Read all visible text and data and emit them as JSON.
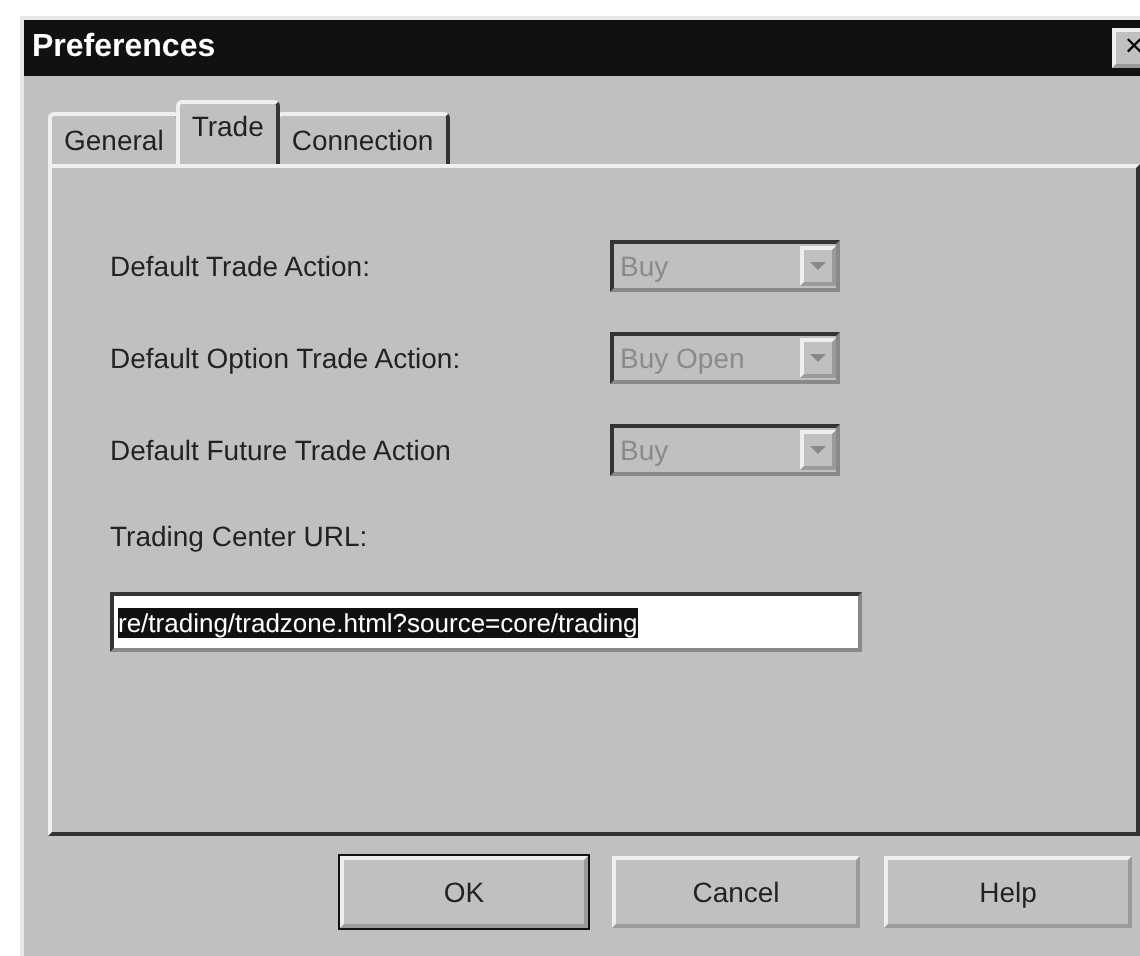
{
  "window": {
    "title": "Preferences",
    "close": "×"
  },
  "tabs": [
    {
      "label": "General",
      "selected": false
    },
    {
      "label": "Trade",
      "selected": true
    },
    {
      "label": "Connection",
      "selected": false
    }
  ],
  "fields": [
    {
      "label": "Default Trade Action:",
      "value": "Buy",
      "disabled": true
    },
    {
      "label": "Default Option Trade Action:",
      "value": "Buy Open",
      "disabled": true
    },
    {
      "label": "Default Future Trade Action",
      "value": "Buy",
      "disabled": true
    }
  ],
  "url": {
    "label": "Trading Center URL:",
    "value": "re/trading/tradzone.html?source=core/trading",
    "selected": true
  },
  "buttons": [
    {
      "label": "OK",
      "default": true
    },
    {
      "label": "Cancel",
      "default": false
    },
    {
      "label": "Help",
      "default": false
    }
  ]
}
